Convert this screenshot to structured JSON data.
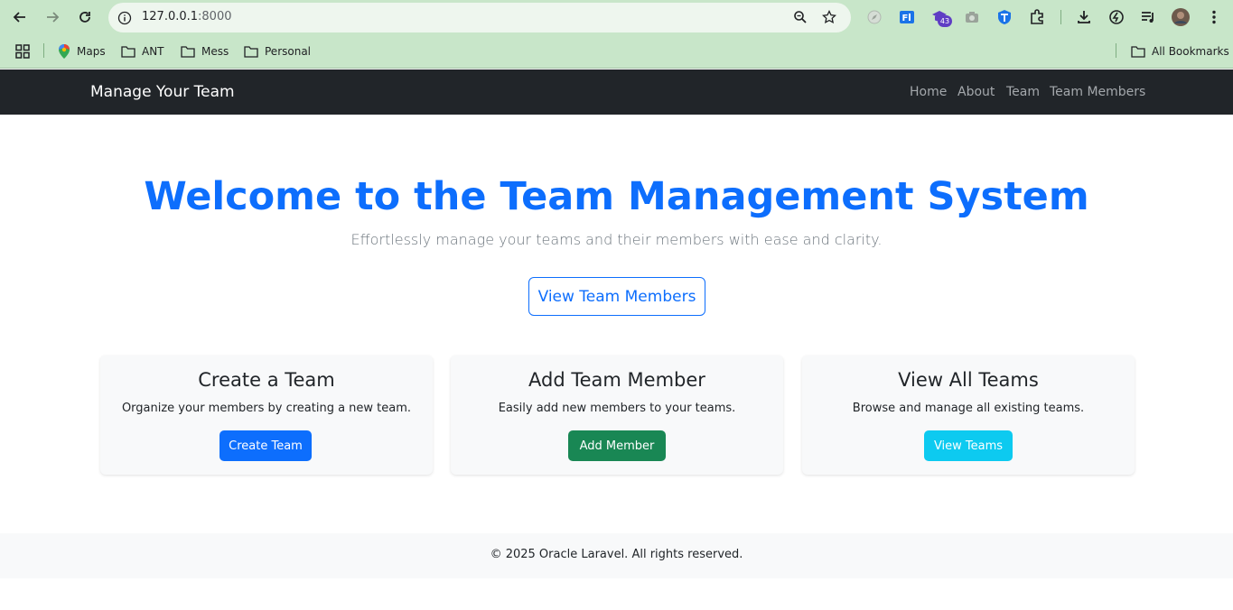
{
  "browser": {
    "url_host": "127.0.0.1",
    "url_port": ":8000",
    "extension_badge": "43",
    "bookmarks": [
      "Maps",
      "ANT",
      "Mess",
      "Personal"
    ],
    "all_bookmarks": "All Bookmarks"
  },
  "navbar": {
    "brand": "Manage Your Team",
    "links": [
      "Home",
      "About",
      "Team",
      "Team Members"
    ]
  },
  "hero": {
    "title": "Welcome to the Team Management System",
    "subtitle": "Effortlessly manage your teams and their members with ease and clarity.",
    "button": "View Team Members"
  },
  "cards": [
    {
      "title": "Create a Team",
      "text": "Organize your members by creating a new team.",
      "button": "Create Team",
      "color": "#0d6efd"
    },
    {
      "title": "Add Team Member",
      "text": "Easily add new members to your teams.",
      "button": "Add Member",
      "color": "#198754"
    },
    {
      "title": "View All Teams",
      "text": "Browse and manage all existing teams.",
      "button": "View Teams",
      "color": "#0dcaf0"
    }
  ],
  "footer": {
    "text": "© 2025 Oracle Laravel. All rights reserved."
  },
  "colors": {
    "primary": "#0d6efd",
    "navbar_bg": "#212529",
    "chrome_bg": "#c8e6c9"
  }
}
